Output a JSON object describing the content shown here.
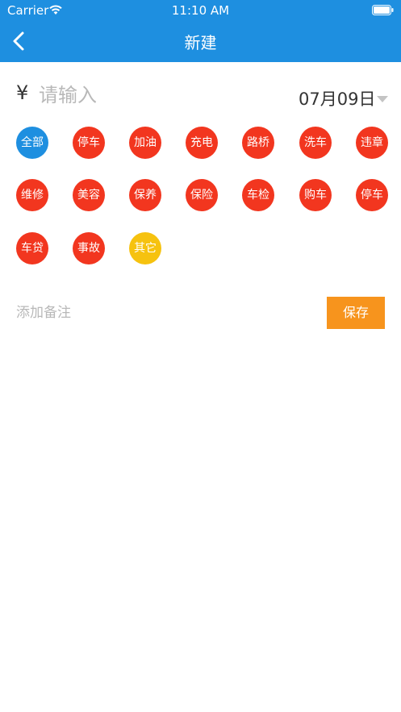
{
  "status_bar": {
    "carrier": "Carrier",
    "time": "11:10 AM"
  },
  "nav": {
    "title": "新建"
  },
  "amount": {
    "currency_symbol": "¥",
    "placeholder": "请输入"
  },
  "date": {
    "value": "07月09日"
  },
  "categories": [
    {
      "label": "全部",
      "color": "#1e8fe0",
      "selected": true
    },
    {
      "label": "停车",
      "color": "#f2361f"
    },
    {
      "label": "加油",
      "color": "#f2361f"
    },
    {
      "label": "充电",
      "color": "#f2361f"
    },
    {
      "label": "路桥",
      "color": "#f2361f"
    },
    {
      "label": "洗车",
      "color": "#f2361f"
    },
    {
      "label": "违章",
      "color": "#f2361f"
    },
    {
      "label": "维修",
      "color": "#f2361f"
    },
    {
      "label": "美容",
      "color": "#f2361f"
    },
    {
      "label": "保养",
      "color": "#f2361f"
    },
    {
      "label": "保险",
      "color": "#f2361f"
    },
    {
      "label": "车检",
      "color": "#f2361f"
    },
    {
      "label": "购车",
      "color": "#f2361f"
    },
    {
      "label": "停车",
      "color": "#f2361f"
    },
    {
      "label": "车贷",
      "color": "#f2361f"
    },
    {
      "label": "事故",
      "color": "#f2361f"
    },
    {
      "label": "其它",
      "color": "#f6c20f"
    }
  ],
  "note": {
    "placeholder": "添加备注"
  },
  "save": {
    "label": "保存",
    "color": "#f7941d"
  },
  "colors": {
    "header": "#1e8fe0"
  }
}
